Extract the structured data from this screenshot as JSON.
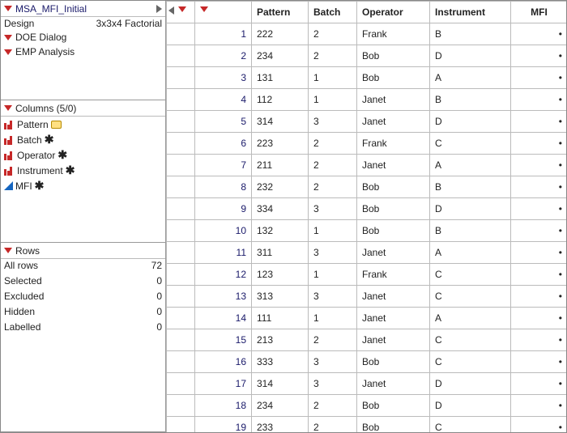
{
  "header": {
    "table_name": "MSA_MFI_Initial",
    "design_label": "Design",
    "design_value": "3x3x4 Factorial",
    "doe": "DOE Dialog",
    "emp": "EMP Analysis"
  },
  "columns_panel": {
    "title": "Columns (5/0)",
    "items": [
      {
        "name": "Pattern",
        "type": "nominal",
        "badge": "label"
      },
      {
        "name": "Batch",
        "type": "nominal",
        "badge": "star"
      },
      {
        "name": "Operator",
        "type": "nominal",
        "badge": "star"
      },
      {
        "name": "Instrument",
        "type": "nominal",
        "badge": "star"
      },
      {
        "name": "MFI",
        "type": "continuous",
        "badge": "star"
      }
    ]
  },
  "rows_panel": {
    "title": "Rows",
    "lines": [
      {
        "label": "All rows",
        "value": "72"
      },
      {
        "label": "Selected",
        "value": "0"
      },
      {
        "label": "Excluded",
        "value": "0"
      },
      {
        "label": "Hidden",
        "value": "0"
      },
      {
        "label": "Labelled",
        "value": "0"
      }
    ]
  },
  "table": {
    "headers": [
      "Pattern",
      "Batch",
      "Operator",
      "Instrument",
      "MFI"
    ],
    "rows": [
      {
        "n": 1,
        "Pattern": "222",
        "Batch": "2",
        "Operator": "Frank",
        "Instrument": "B",
        "MFI": "•"
      },
      {
        "n": 2,
        "Pattern": "234",
        "Batch": "2",
        "Operator": "Bob",
        "Instrument": "D",
        "MFI": "•"
      },
      {
        "n": 3,
        "Pattern": "131",
        "Batch": "1",
        "Operator": "Bob",
        "Instrument": "A",
        "MFI": "•"
      },
      {
        "n": 4,
        "Pattern": "112",
        "Batch": "1",
        "Operator": "Janet",
        "Instrument": "B",
        "MFI": "•"
      },
      {
        "n": 5,
        "Pattern": "314",
        "Batch": "3",
        "Operator": "Janet",
        "Instrument": "D",
        "MFI": "•"
      },
      {
        "n": 6,
        "Pattern": "223",
        "Batch": "2",
        "Operator": "Frank",
        "Instrument": "C",
        "MFI": "•"
      },
      {
        "n": 7,
        "Pattern": "211",
        "Batch": "2",
        "Operator": "Janet",
        "Instrument": "A",
        "MFI": "•"
      },
      {
        "n": 8,
        "Pattern": "232",
        "Batch": "2",
        "Operator": "Bob",
        "Instrument": "B",
        "MFI": "•"
      },
      {
        "n": 9,
        "Pattern": "334",
        "Batch": "3",
        "Operator": "Bob",
        "Instrument": "D",
        "MFI": "•"
      },
      {
        "n": 10,
        "Pattern": "132",
        "Batch": "1",
        "Operator": "Bob",
        "Instrument": "B",
        "MFI": "•"
      },
      {
        "n": 11,
        "Pattern": "311",
        "Batch": "3",
        "Operator": "Janet",
        "Instrument": "A",
        "MFI": "•"
      },
      {
        "n": 12,
        "Pattern": "123",
        "Batch": "1",
        "Operator": "Frank",
        "Instrument": "C",
        "MFI": "•"
      },
      {
        "n": 13,
        "Pattern": "313",
        "Batch": "3",
        "Operator": "Janet",
        "Instrument": "C",
        "MFI": "•"
      },
      {
        "n": 14,
        "Pattern": "111",
        "Batch": "1",
        "Operator": "Janet",
        "Instrument": "A",
        "MFI": "•"
      },
      {
        "n": 15,
        "Pattern": "213",
        "Batch": "2",
        "Operator": "Janet",
        "Instrument": "C",
        "MFI": "•"
      },
      {
        "n": 16,
        "Pattern": "333",
        "Batch": "3",
        "Operator": "Bob",
        "Instrument": "C",
        "MFI": "•"
      },
      {
        "n": 17,
        "Pattern": "314",
        "Batch": "3",
        "Operator": "Janet",
        "Instrument": "D",
        "MFI": "•"
      },
      {
        "n": 18,
        "Pattern": "234",
        "Batch": "2",
        "Operator": "Bob",
        "Instrument": "D",
        "MFI": "•"
      },
      {
        "n": 19,
        "Pattern": "233",
        "Batch": "2",
        "Operator": "Bob",
        "Instrument": "C",
        "MFI": "•"
      }
    ]
  }
}
